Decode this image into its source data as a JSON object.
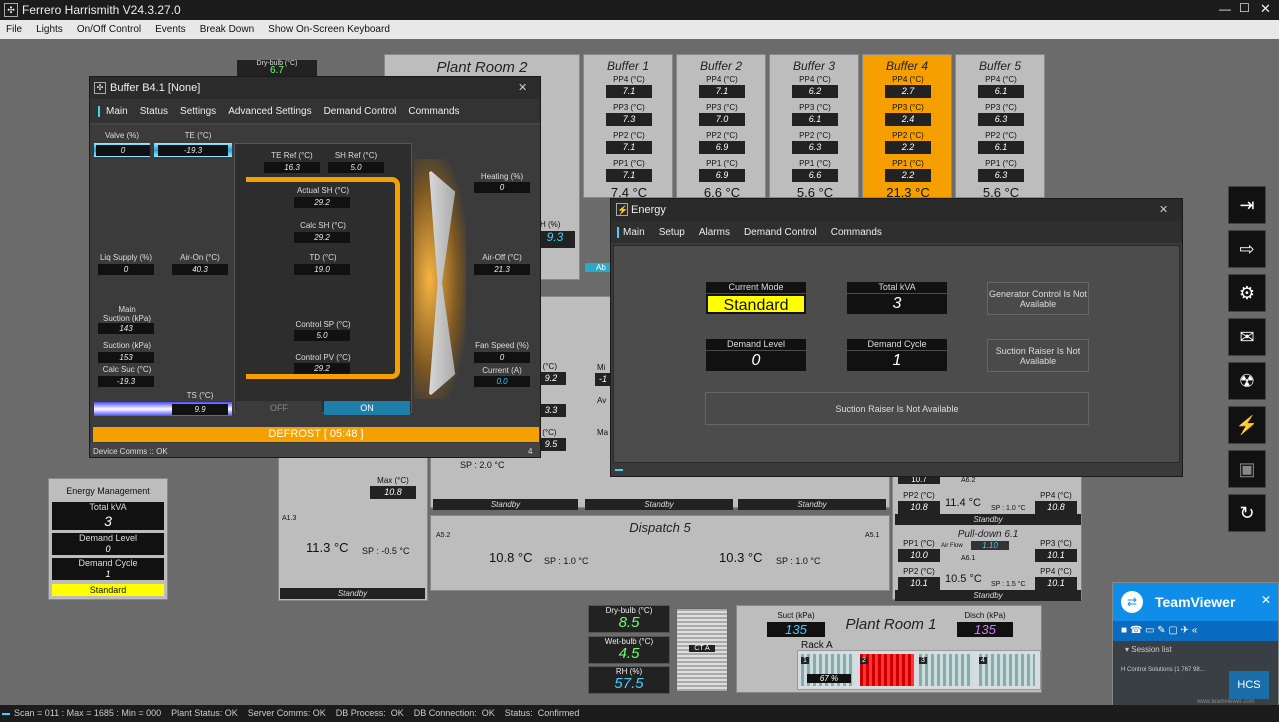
{
  "app": {
    "title": "Ferrero Harrismith V24.3.27.0"
  },
  "menu": [
    "File",
    "Lights",
    "On/Off Control",
    "Events",
    "Break Down",
    "Show On-Screen Keyboard"
  ],
  "drybulb_top": {
    "label": "Dry-bulb (°C)",
    "value": "6.7"
  },
  "plantroom2": {
    "title": "Plant Room 2",
    "rh_label": "H (%)",
    "rh_value": "9.3",
    "abt": "Ab"
  },
  "buffers": [
    {
      "title": "Buffer 1",
      "pp4": "7.1",
      "pp3": "7.3",
      "pp2": "7.1",
      "pp1": "7.1",
      "temp": "7.4 °C",
      "active": false
    },
    {
      "title": "Buffer 2",
      "pp4": "7.1",
      "pp3": "7.0",
      "pp2": "6.9",
      "pp1": "6.9",
      "temp": "6.6 °C",
      "active": false
    },
    {
      "title": "Buffer 3",
      "pp4": "6.2",
      "pp3": "6.1",
      "pp2": "6.3",
      "pp1": "6.6",
      "temp": "5.6 °C",
      "active": false
    },
    {
      "title": "Buffer 4",
      "pp4": "2.7",
      "pp3": "2.4",
      "pp2": "2.2",
      "pp1": "2.2",
      "temp": "21.3 °C",
      "active": true
    },
    {
      "title": "Buffer 5",
      "pp4": "6.1",
      "pp3": "6.3",
      "pp2": "6.1",
      "pp1": "6.3",
      "temp": "5.6 °C",
      "active": false
    }
  ],
  "pp_labels": {
    "pp4": "PP4 (°C)",
    "pp3": "PP3 (°C)",
    "pp2": "PP2 (°C)",
    "pp1": "PP1 (°C)"
  },
  "buffer_win": {
    "title": "Buffer B4.1 [None]",
    "tabs": [
      "Main",
      "Status",
      "Settings",
      "Advanced Settings",
      "Demand Control",
      "Commands"
    ],
    "valve_label": "Valve (%)",
    "valve": "0",
    "te_label": "TE (°C)",
    "te": "-19.3",
    "te_ref_label": "TE Ref (°C)",
    "te_ref": "16.3",
    "sh_ref_label": "SH Ref (°C)",
    "sh_ref": "5.0",
    "actual_sh_label": "Actual SH (°C)",
    "actual_sh": "29.2",
    "calc_sh_label": "Calc SH (°C)",
    "calc_sh": "29.2",
    "td_label": "TD (°C)",
    "td": "19.0",
    "control_sp_label": "Control SP (°C)",
    "control_sp": "5.0",
    "control_pv_label": "Control PV (°C)",
    "control_pv": "29.2",
    "liq_label": "Liq Supply (%)",
    "liq": "0",
    "air_on_label": "Air-On (°C)",
    "air_on": "40.3",
    "main_suction_label": "Main\nSuction (kPa)",
    "main_suction": "143",
    "suction_label": "Suction (kPa)",
    "suction": "153",
    "calc_suc_label": "Calc Suc (°C)",
    "calc_suc": "-19.3",
    "ts_label": "TS (°C)",
    "ts": "9.9",
    "heating_label": "Heating (%)",
    "heating": "0",
    "air_off_label": "Air-Off (°C)",
    "air_off": "21.3",
    "fan_label": "Fan Speed (%)",
    "fan": "0",
    "current_label": "Current (A)",
    "current": "0.0",
    "off": "OFF",
    "on": "ON",
    "defrost": "DEFROST [ 05:48 ]",
    "comms": "Device Comms :: OK",
    "comms_num": "4"
  },
  "energy_win": {
    "title": "Energy",
    "tabs": [
      "Main",
      "Setup",
      "Alarms",
      "Demand Control",
      "Commands"
    ],
    "current_mode_label": "Current Mode",
    "current_mode": "Standard",
    "total_kva_label": "Total kVA",
    "total_kva": "3",
    "demand_level_label": "Demand Level",
    "demand_level": "0",
    "demand_cycle_label": "Demand Cycle",
    "demand_cycle": "1",
    "gen_control": "Generator Control Is Not Available",
    "suction_raiser_short": "Suction Raiser Is Not Available",
    "suction_raiser": "Suction Raiser Is Not Available"
  },
  "energy_mgmt": {
    "title": "Energy Management",
    "total_kva_label": "Total kVA",
    "total_kva": "3",
    "demand_level_label": "Demand Level",
    "demand_level": "0",
    "demand_cycle_label": "Demand Cycle",
    "demand_cycle": "1",
    "mode": "Standard"
  },
  "behind": {
    "r1": "9.2",
    "r2": "3.3",
    "r3": "9.5",
    "r1_label": "n (°C)",
    "r3_label": "x (°C)",
    "mi": "Mi",
    "mi_val": "-1",
    "av": "Av",
    "ma": "Ma",
    "sp_top": "SP : 2.0 °C",
    "max_label": "Max (°C)",
    "max_val": "10.8",
    "a13": "A1.3",
    "a13_temp": "11.3 °C",
    "a13_sp": "SP : -0.5 °C",
    "a52": "A5.2",
    "a51": "A5.1",
    "standby": "Standby",
    "dispatch5": "Dispatch 5",
    "d5_t1": "10.8 °C",
    "d5_sp1": "SP : 1.0 °C",
    "d5_t2": "10.3 °C",
    "d5_sp2": "SP : 1.0 °C",
    "pd_row1_pp2": "10.8",
    "pd_row1_pp4": "10.8",
    "pd_row1_temp": "11.4 °C",
    "pd_row1_sp": "SP : 1.0 °C",
    "a62": "A6.2",
    "pd_row1_top": "10.7",
    "pulldown": "Pull-down 6.1",
    "pd_pp1": "10.0",
    "pd_pp3": "10.1",
    "pd_pp2": "10.1",
    "pd_pp4": "10.1",
    "airflow_label": "Air Flow",
    "airflow": "1.10",
    "a61": "A6.1",
    "pd_temp": "10.5 °C",
    "pd_sp": "SP : 1.5 °C"
  },
  "bottom": {
    "drybulb_label": "Dry-bulb (°C)",
    "drybulb": "8.5",
    "wetbulb_label": "Wet-bulb (°C)",
    "wetbulb": "4.5",
    "rh_label": "RH (%)",
    "rh": "57.5",
    "cta": "CT A",
    "plantroom1": "Plant Room 1",
    "suct_label": "Suct (kPa)",
    "suct": "135",
    "disch_label": "Disch (kPa)",
    "disch": "135",
    "rack": "Rack A",
    "comp1_pct": "67",
    "pct": "%",
    "c1": "1",
    "c2": "2",
    "c3": "3",
    "c4": "4"
  },
  "teamviewer": {
    "title": "TeamViewer",
    "session": "Session list",
    "entry": "H Control Solutions (1 767 98...",
    "url": "www.teamviewer.com",
    "logo": "HCS"
  },
  "statusbar": "Scan = 011 : Max = 1685 : Min = 000    Plant Status: OK    Server Comms: OK    DB Process:  OK    DB Connection:  OK    Status:  Confirmed",
  "colors": {
    "orange": "#f5a000",
    "yellow": "#ffff00",
    "cyan": "#3fd0ff",
    "green": "#6cff6c",
    "teal": "#2aa8c8"
  }
}
